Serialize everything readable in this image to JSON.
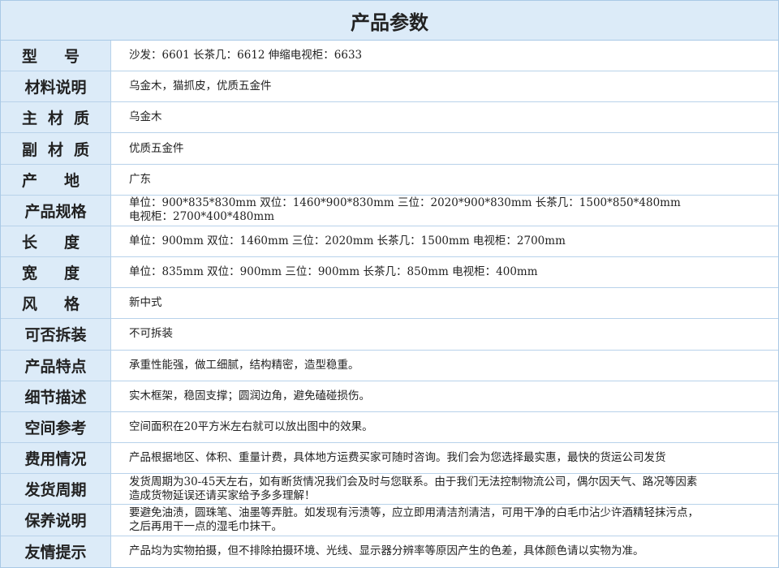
{
  "title": "产品参数",
  "rows": [
    {
      "label": "型号",
      "value": "沙发：6601  长茶几：6612  伸缩电视柜：6633"
    },
    {
      "label": "材料说明",
      "value": "乌金木，猫抓皮，优质五金件"
    },
    {
      "label": "主材质",
      "value": "乌金木"
    },
    {
      "label": "副材质",
      "value": "优质五金件"
    },
    {
      "label": "产地",
      "value": "广东"
    },
    {
      "label": "产品规格",
      "value": "单位：900*835*830mm  双位：1460*900*830mm  三位：2020*900*830mm   长茶几：1500*850*480mm\n电视柜：2700*400*480mm"
    },
    {
      "label": "长度",
      "value": "单位：900mm  双位：1460mm  三位：2020mm   长茶几：1500mm   电视柜：2700mm"
    },
    {
      "label": "宽度",
      "value": "单位：835mm  双位：900mm  三位：900mm   长茶几：850mm   电视柜：400mm"
    },
    {
      "label": "风格",
      "value": "新中式"
    },
    {
      "label": "可否拆装",
      "value": "不可拆装"
    },
    {
      "label": "产品特点",
      "value": "承重性能强，做工细腻，结构精密，造型稳重。"
    },
    {
      "label": "细节描述",
      "value": "实木框架，稳固支撑；圆润边角，避免磕碰损伤。"
    },
    {
      "label": "空间参考",
      "value": "空间面积在20平方米左右就可以放出图中的效果。"
    },
    {
      "label": "费用情况",
      "value": "产品根据地区、体积、重量计费，具体地方运费买家可随时咨询。我们会为您选择最实惠，最快的货运公司发货"
    },
    {
      "label": "发货周期",
      "value": "发货周期为30-45天左右，如有断货情况我们会及时与您联系。由于我们无法控制物流公司，偶尔因天气、路况等因素\n造成货物延误还请买家给予多多理解！"
    },
    {
      "label": "保养说明",
      "value": "要避免油渍，圆珠笔、油墨等弄脏。如发现有污渍等，应立即用清洁剂清洁，可用干净的白毛巾沾少许酒精轻抹污点，\n之后再用干一点的湿毛巾抹干。"
    },
    {
      "label": "友情提示",
      "value": "产品均为实物拍摄，但不排除拍摄环境、光线、显示器分辨率等原因产生的色差，具体颜色请以实物为准。"
    }
  ]
}
